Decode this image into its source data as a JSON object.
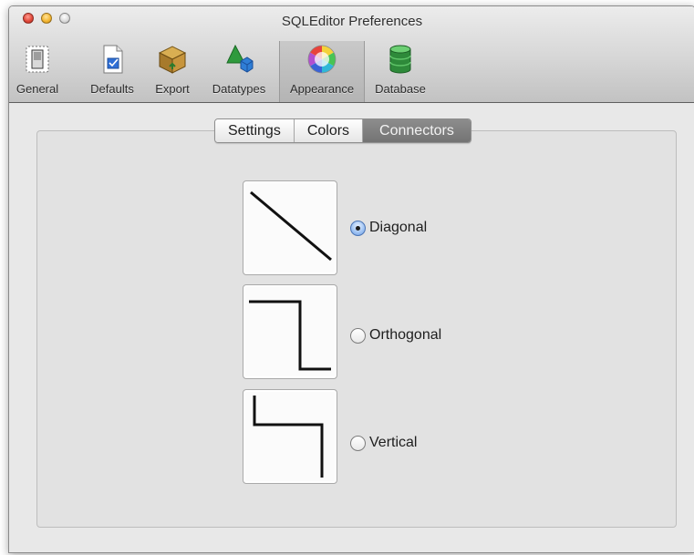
{
  "window": {
    "title": "SQLEditor Preferences"
  },
  "toolbar": {
    "items": [
      {
        "label": "General",
        "icon": "switch-icon"
      },
      {
        "label": "Defaults",
        "icon": "document-icon"
      },
      {
        "label": "Export",
        "icon": "box-icon"
      },
      {
        "label": "Datatypes",
        "icon": "shapes-icon"
      },
      {
        "label": "Appearance",
        "icon": "color-wheel-icon",
        "selected": true
      },
      {
        "label": "Database",
        "icon": "database-icon"
      }
    ]
  },
  "tabs": [
    {
      "label": "Settings"
    },
    {
      "label": "Colors"
    },
    {
      "label": "Connectors",
      "active": true
    }
  ],
  "connector_options": [
    {
      "label": "Diagonal",
      "selected": true
    },
    {
      "label": "Orthogonal",
      "selected": false
    },
    {
      "label": "Vertical",
      "selected": false
    }
  ],
  "colors": {
    "radio_selected": "#6d9be0",
    "tab_active": "#7d7d7d"
  }
}
